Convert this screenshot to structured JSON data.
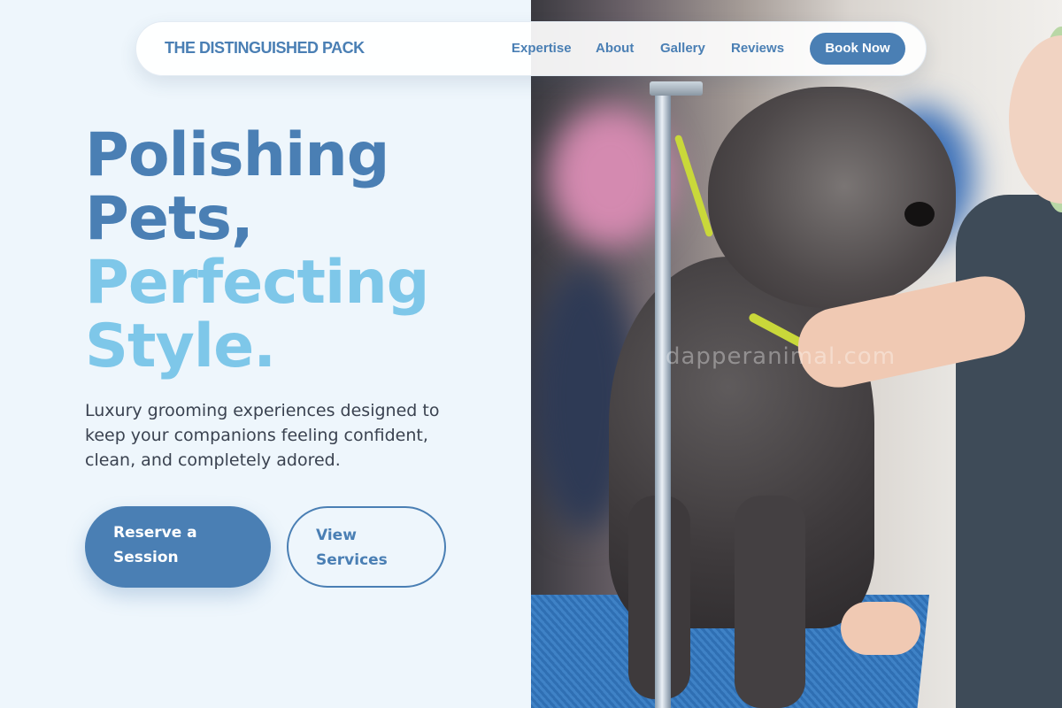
{
  "nav": {
    "brand": "THE DISTINGUISHED PACK",
    "links": [
      "Expertise",
      "About",
      "Gallery",
      "Reviews"
    ],
    "cta": "Book Now"
  },
  "hero": {
    "headline_line1": "Polishing",
    "headline_line2": "Pets,",
    "headline_line3": "Perfecting",
    "headline_line4": "Style.",
    "tagline": "Luxury grooming experiences designed to keep your companions feeling confident, clean, and completely adored.",
    "primary_button": "Reserve a Session",
    "secondary_button": "View Services"
  },
  "photo": {
    "watermark": "dapperanimal.com"
  },
  "colors": {
    "accent": "#4a7fb4",
    "accent_light": "#7ec7e9",
    "background": "#eef6fc",
    "text": "#3a4250"
  }
}
